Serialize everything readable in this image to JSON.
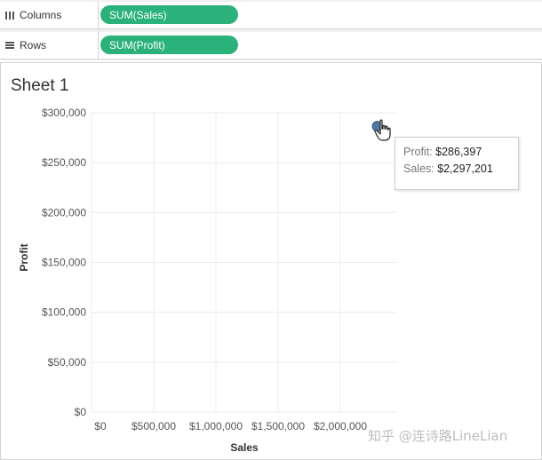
{
  "shelves": {
    "columns": {
      "label": "Columns",
      "icon": "columns-icon",
      "pill": "SUM(Sales)"
    },
    "rows": {
      "label": "Rows",
      "icon": "rows-icon",
      "pill": "SUM(Profit)"
    }
  },
  "sheet": {
    "title": "Sheet 1"
  },
  "tooltip": {
    "profit_key": "Profit:",
    "profit_val": "$286,397",
    "sales_key": "Sales:",
    "sales_val": "$2,297,201"
  },
  "watermark": "知乎 @连诗路LineLian",
  "colors": {
    "pill": "#2bb27a",
    "mark": "#4e79a7",
    "grid": "#ececec"
  },
  "chart_data": {
    "type": "scatter",
    "xlabel": "Sales",
    "ylabel": "Profit",
    "x_ticks": [
      0,
      500000,
      1000000,
      1500000,
      2000000
    ],
    "x_tick_labels": [
      "$0",
      "$500,000",
      "$1,000,000",
      "$1,500,000",
      "$2,000,000"
    ],
    "y_ticks": [
      0,
      50000,
      100000,
      150000,
      200000,
      250000,
      300000
    ],
    "y_tick_labels": [
      "$0",
      "$50,000",
      "$100,000",
      "$150,000",
      "$200,000",
      "$250,000",
      "$300,000"
    ],
    "xlim": [
      0,
      2450000
    ],
    "ylim": [
      0,
      300000
    ],
    "grid": true,
    "points": [
      {
        "x": 2297201,
        "y": 286397
      }
    ]
  }
}
